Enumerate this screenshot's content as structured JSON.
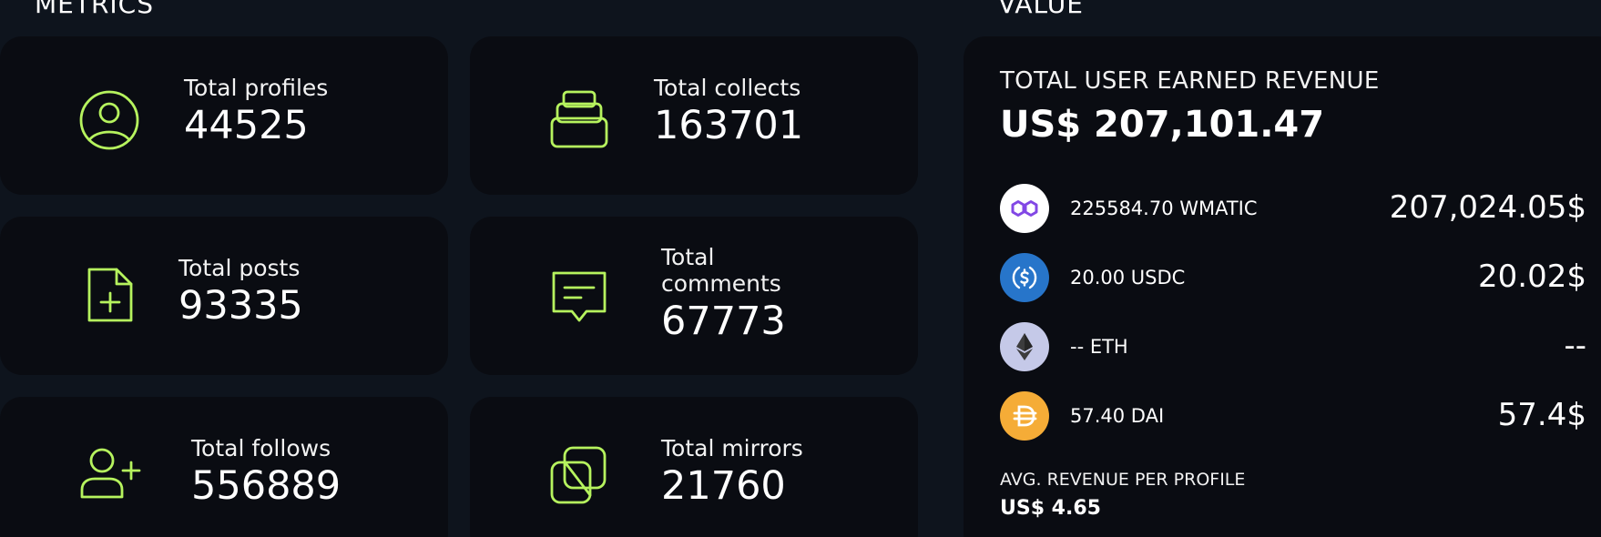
{
  "sections": {
    "metrics_label": "METRICS",
    "value_label": "VALUE"
  },
  "metrics": [
    {
      "label": "Total profiles",
      "value": "44525",
      "icon": "user-circle-icon"
    },
    {
      "label": "Total collects",
      "value": "163701",
      "icon": "bag-icon"
    },
    {
      "label": "Total posts",
      "value": "93335",
      "icon": "file-plus-icon"
    },
    {
      "label": "Total comments",
      "value": "67773",
      "icon": "message-icon"
    },
    {
      "label": "Total follows",
      "value": "556889",
      "icon": "user-plus-icon"
    },
    {
      "label": "Total mirrors",
      "value": "21760",
      "icon": "copy-icon"
    }
  ],
  "revenue": {
    "title": "TOTAL USER EARNED REVENUE",
    "total": "US$ 207,101.47",
    "tokens": [
      {
        "amount": "225584.70 WMATIC",
        "usd": "207,024.05$",
        "icon": "polygon-icon",
        "color": "#ffffff"
      },
      {
        "amount": "20.00 USDC",
        "usd": "20.02$",
        "icon": "usdc-icon",
        "color": "#2775ca"
      },
      {
        "amount": "-- ETH",
        "usd": "--",
        "icon": "ethereum-icon",
        "color": "#c5c9e8"
      },
      {
        "amount": "57.40 DAI",
        "usd": "57.4$",
        "icon": "dai-icon",
        "color": "#f5ac37"
      }
    ],
    "avg_label": "AVG. REVENUE PER PROFILE",
    "avg_value": "US$ 4.65"
  },
  "colors": {
    "accent": "#b6f35e",
    "background": "#0e141d",
    "card": "#0a0c12"
  }
}
